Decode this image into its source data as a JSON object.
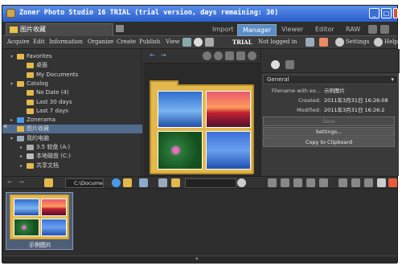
{
  "window": {
    "title": "Zoner Photo Studio 16 TRIAL (trial version, days remaining: 30)",
    "controls": [
      "_",
      "□",
      "×"
    ]
  },
  "modebar": {
    "folder_tab": "图片收藏",
    "tabs": [
      "Import",
      "Manager",
      "Viewer",
      "Editor",
      "RAW"
    ],
    "active_tab": "Manager"
  },
  "menubar": {
    "items": [
      "Acquire",
      "Edit",
      "Information",
      "Organize",
      "Create",
      "Publish",
      "View"
    ],
    "trial_label": "TRIAL",
    "login_label": "Not logged in",
    "settings_label": "Settings",
    "help_label": "Help"
  },
  "tree": {
    "items": [
      {
        "label": "Favorites",
        "expander": "▾",
        "icon": "star-folder-icon"
      },
      {
        "label": "桌面",
        "expander": "",
        "icon": "folder-icon"
      },
      {
        "label": "My Documents",
        "expander": "",
        "icon": "folder-icon"
      },
      {
        "label": "Catalog",
        "expander": "▾",
        "icon": "catalog-icon"
      },
      {
        "label": "No Date (4)",
        "expander": "",
        "icon": "folder-icon"
      },
      {
        "label": "Last 30 days",
        "expander": "",
        "icon": "folder-icon"
      },
      {
        "label": "Last 7 days",
        "expander": "",
        "icon": "folder-icon"
      },
      {
        "label": "Zonerama",
        "expander": "▸",
        "icon": "globe-icon"
      },
      {
        "label": "图片收藏",
        "expander": "",
        "icon": "folder-icon"
      },
      {
        "label": "我的电脑",
        "expander": "▾",
        "icon": "computer-icon"
      },
      {
        "label": "3.5 软盘 (A:)",
        "expander": "▸",
        "icon": "floppy-icon"
      },
      {
        "label": "本地磁盘 (C:)",
        "expander": "▸",
        "icon": "disk-icon"
      },
      {
        "label": "共享文档",
        "expander": "▸",
        "icon": "folder-icon"
      }
    ],
    "selected_index": 8
  },
  "properties": {
    "section": "General",
    "fields": [
      {
        "key": "Filename with ex...",
        "value": "示例图片"
      },
      {
        "key": "Created:",
        "value": "2011年3月31日 16:26:08"
      },
      {
        "key": "Modified:",
        "value": "2011年3月31日 16:26:2"
      }
    ],
    "buttons": {
      "save": "Save",
      "settings": "Settings...",
      "copy": "Copy to Clipboard"
    }
  },
  "pathbar": {
    "path": "C:\\Document"
  },
  "filmstrip": {
    "items": [
      {
        "label": "示例图片"
      }
    ]
  },
  "colors": {
    "accent": "#5a8ec8",
    "title_bar": "#2a5ecc",
    "folder": "#e3b84c",
    "selection": "#516c8e"
  }
}
